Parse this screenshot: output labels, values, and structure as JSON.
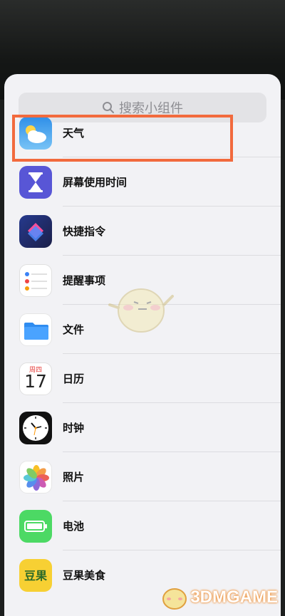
{
  "search": {
    "placeholder": "搜索小组件"
  },
  "widgets": [
    {
      "label": "天气",
      "icon": "weather-icon"
    },
    {
      "label": "屏幕使用时间",
      "icon": "hourglass-icon"
    },
    {
      "label": "快捷指令",
      "icon": "shortcuts-icon"
    },
    {
      "label": "提醒事项",
      "icon": "reminders-icon"
    },
    {
      "label": "文件",
      "icon": "files-folder-icon"
    },
    {
      "label": "日历",
      "icon": "calendar-icon",
      "weekday": "周四",
      "day": "17"
    },
    {
      "label": "时钟",
      "icon": "clock-icon"
    },
    {
      "label": "照片",
      "icon": "photos-icon"
    },
    {
      "label": "电池",
      "icon": "battery-icon"
    },
    {
      "label": "豆果美食",
      "icon": "douguo-icon",
      "icon_text": "豆果"
    }
  ],
  "highlight_color": "#f26a3d",
  "watermark": {
    "text": "3DMGAME"
  }
}
